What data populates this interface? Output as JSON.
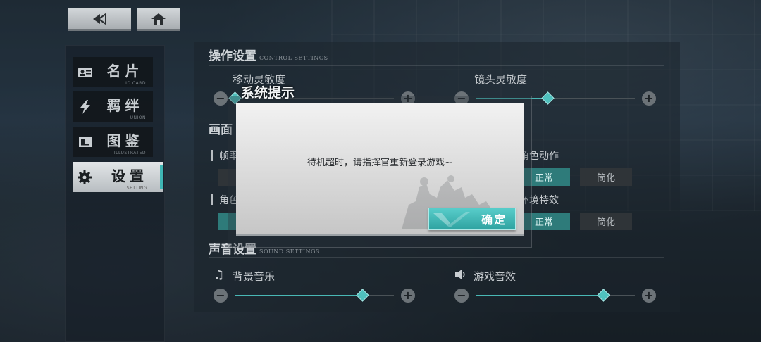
{
  "nav": {
    "back_icon": "back-arrow-icon",
    "home_icon": "home-icon"
  },
  "menu": {
    "items": [
      {
        "label": "名片",
        "sub": "ID CARD",
        "icon": "id-card-icon"
      },
      {
        "label": "羁绊",
        "sub": "UNION",
        "icon": "lightning-icon"
      },
      {
        "label": "图鉴",
        "sub": "ILLUSTRATED",
        "icon": "book-icon"
      },
      {
        "label": "设置",
        "sub": "SETTING",
        "icon": "gear-icon",
        "selected": true
      }
    ]
  },
  "control": {
    "title": "操作设置",
    "title_en": "CONTROL SETTINGS",
    "move_sensitivity_label": "移动灵敏度",
    "move_sensitivity": 0.0,
    "camera_sensitivity_label": "镜头灵敏度",
    "camera_sensitivity": 0.45
  },
  "graphics": {
    "title": "画面",
    "frame_label": "帧率",
    "char_label": "角色",
    "char_action_label": "角色动作",
    "env_effect_label": "环境特效",
    "normal_label": "正常",
    "simple_label": "简化",
    "char_action_value": "正常",
    "env_effect_value": "正常"
  },
  "sound": {
    "title": "声音设置",
    "title_en": "SOUND SETTINGS",
    "bgm_label": "背景音乐",
    "bgm_value": 0.8,
    "sfx_label": "游戏音效",
    "sfx_value": 0.8
  },
  "modal": {
    "title": "系统提示",
    "message": "待机超时，请指挥官重新登录游戏~",
    "confirm_label": "确定"
  },
  "colors": {
    "accent": "#49b8b5",
    "modal_bg": "#e2e2e2"
  }
}
